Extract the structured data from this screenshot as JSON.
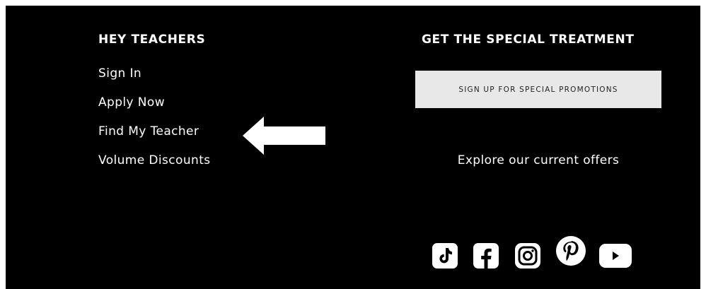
{
  "teachers": {
    "heading": "HEY TEACHERS",
    "links": [
      "Sign In",
      "Apply Now",
      "Find My Teacher",
      "Volume Discounts"
    ]
  },
  "promo": {
    "heading": "GET THE SPECIAL TREATMENT",
    "button_label": "SIGN UP FOR SPECIAL PROMOTIONS",
    "offers_link": "Explore our current offers"
  },
  "social": {
    "icons": [
      "tiktok-icon",
      "facebook-icon",
      "instagram-icon",
      "pinterest-icon",
      "youtube-icon"
    ]
  },
  "colors": {
    "background": "#000000",
    "text": "#ffffff",
    "button_bg": "#e8e8e8",
    "button_text": "#222222"
  }
}
